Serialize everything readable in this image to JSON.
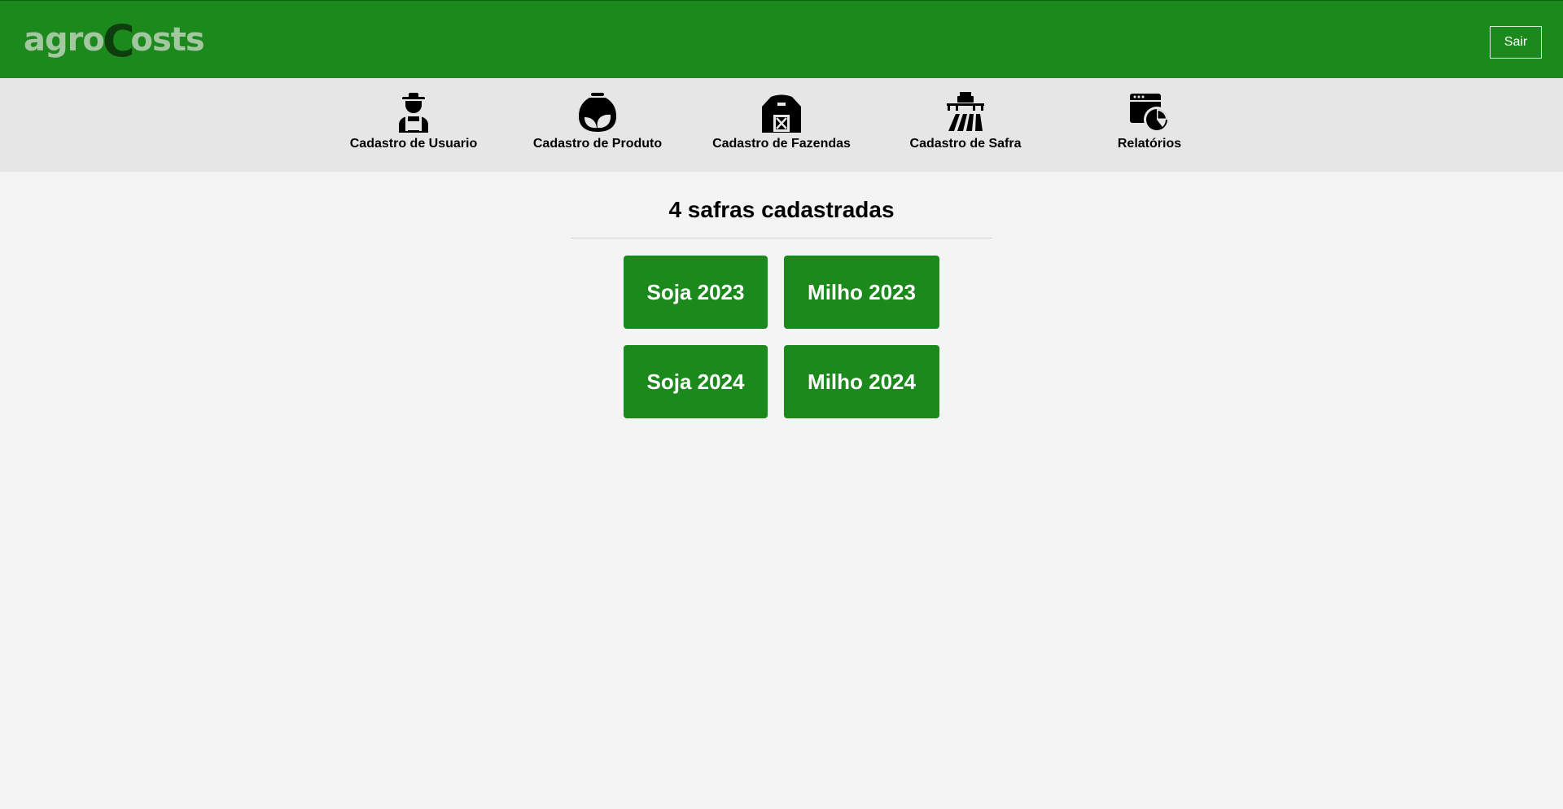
{
  "header": {
    "logo": {
      "part1": "agro",
      "part2": "C",
      "part3": "osts"
    },
    "logout_label": "Sair"
  },
  "nav": {
    "items": [
      {
        "label": "Cadastro de Usuario",
        "icon": "farmer-icon"
      },
      {
        "label": "Cadastro de Produto",
        "icon": "seed-bag-icon"
      },
      {
        "label": "Cadastro de Fazendas",
        "icon": "barn-icon"
      },
      {
        "label": "Cadastro de Safra",
        "icon": "tractor-field-icon"
      },
      {
        "label": "Relatórios",
        "icon": "report-chart-icon"
      }
    ]
  },
  "main": {
    "heading": "4 safras cadastradas",
    "safras": [
      "Soja 2023",
      "Milho 2023",
      "Soja 2024",
      "Milho 2024"
    ]
  },
  "colors": {
    "brand_green": "#1c891c",
    "nav_bg": "#e6e6e6",
    "page_bg": "#f4f4f4"
  }
}
